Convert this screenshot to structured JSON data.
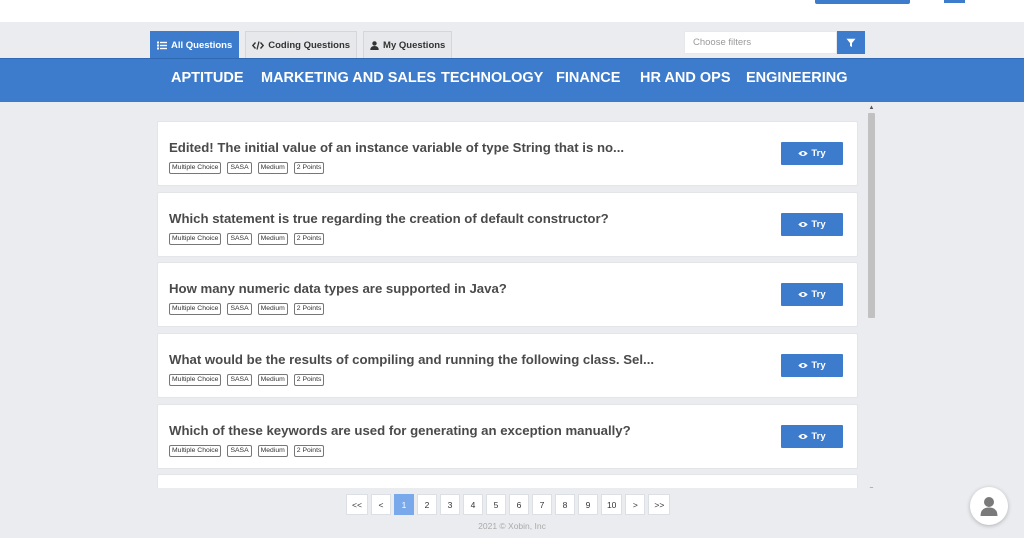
{
  "tabs": [
    {
      "label": "All Questions",
      "icon": "list-icon",
      "active": true
    },
    {
      "label": "Coding Questions",
      "icon": "code-icon",
      "active": false
    },
    {
      "label": "My Questions",
      "icon": "user-icon",
      "active": false
    }
  ],
  "filter": {
    "placeholder": "Choose filters",
    "icon": "filter-icon"
  },
  "categories": [
    "APTITUDE",
    "MARKETING AND SALES",
    "TECHNOLOGY",
    "FINANCE",
    "HR AND OPS",
    "ENGINEERING"
  ],
  "questions": [
    {
      "title": "Edited! The initial value of an instance variable of type String that is no...",
      "tags": [
        "Multiple Choice",
        "SASA",
        "Medium",
        "2 Points"
      ],
      "action": "Try"
    },
    {
      "title": "Which statement is true regarding the creation of default constructor?",
      "tags": [
        "Multiple Choice",
        "SASA",
        "Medium",
        "2 Points"
      ],
      "action": "Try"
    },
    {
      "title": "How many numeric data types are supported in Java?",
      "tags": [
        "Multiple Choice",
        "SASA",
        "Medium",
        "2 Points"
      ],
      "action": "Try"
    },
    {
      "title": "What would be the results of compiling and running the following class. Sel...",
      "tags": [
        "Multiple Choice",
        "SASA",
        "Medium",
        "2 Points"
      ],
      "action": "Try"
    },
    {
      "title": "Which of these keywords are used for generating an exception manually?",
      "tags": [
        "Multiple Choice",
        "SASA",
        "Medium",
        "2 Points"
      ],
      "action": "Try"
    }
  ],
  "pagination": {
    "items": [
      "<<",
      "<",
      "1",
      "2",
      "3",
      "4",
      "5",
      "6",
      "7",
      "8",
      "9",
      "10",
      ">",
      ">>"
    ],
    "current": "1"
  },
  "footer": "2021 © Xobin, Inc",
  "colors": {
    "primary": "#3d7ccc",
    "page_active": "#79a9ea",
    "background": "#eaecef"
  }
}
